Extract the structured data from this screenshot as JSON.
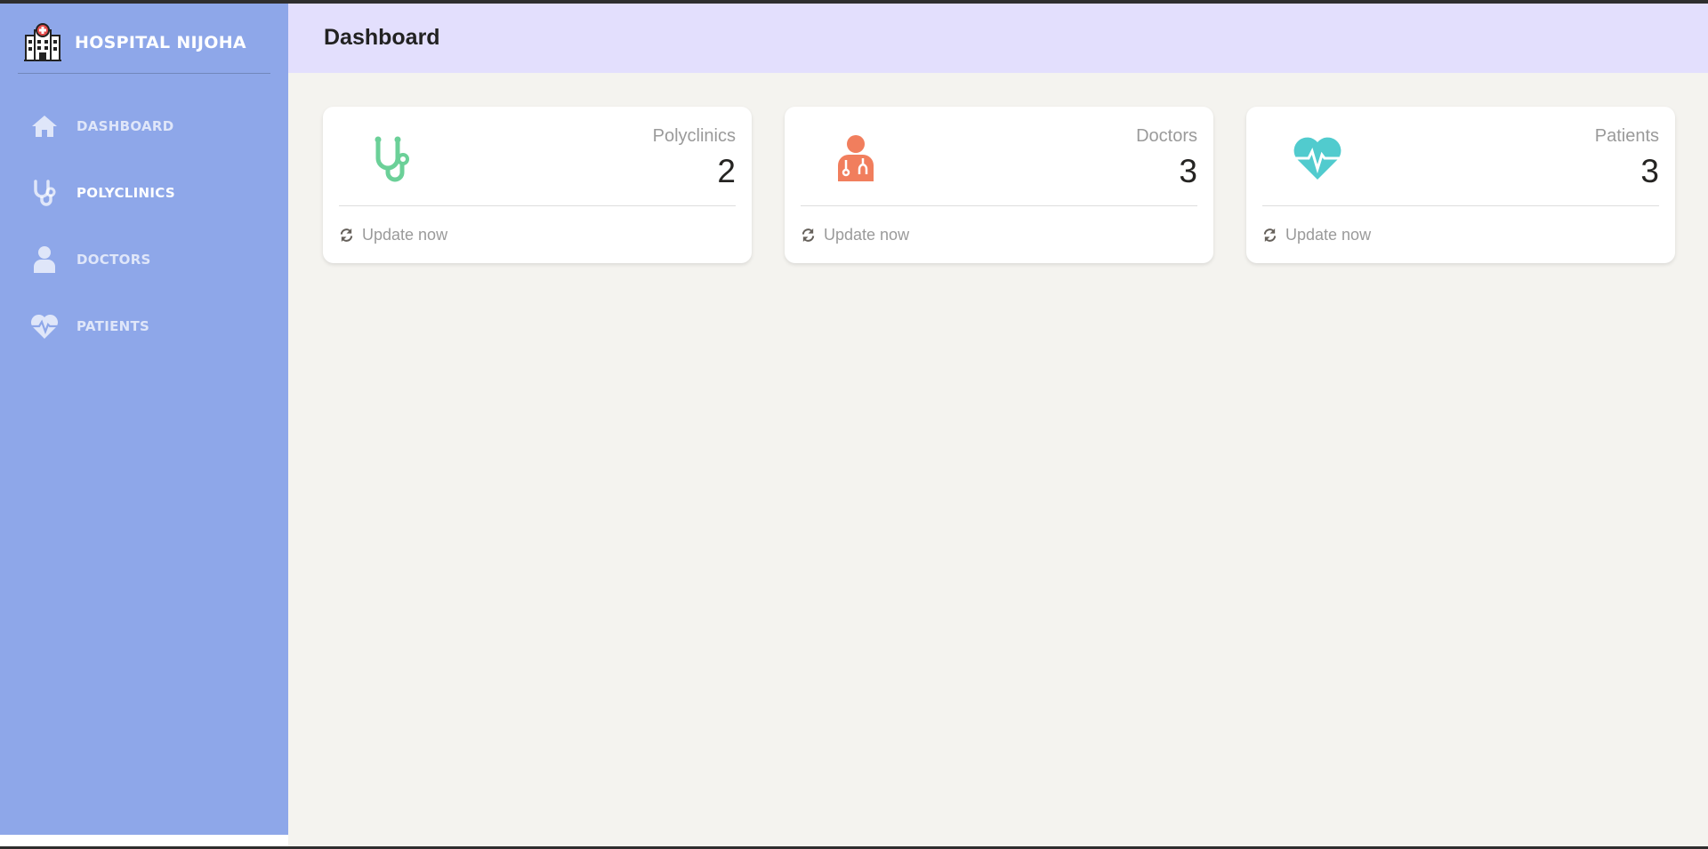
{
  "brand": {
    "name": "HOSPITAL NIJOHA",
    "logo": "hospital-building-icon"
  },
  "sidebar": {
    "items": [
      {
        "label": "DASHBOARD",
        "icon": "home-icon",
        "active": false
      },
      {
        "label": "POLYCLINICS",
        "icon": "stethoscope-icon",
        "active": true
      },
      {
        "label": "DOCTORS",
        "icon": "doctor-icon",
        "active": false
      },
      {
        "label": "PATIENTS",
        "icon": "heartbeat-icon",
        "active": false
      }
    ]
  },
  "header": {
    "title": "Dashboard"
  },
  "cards": [
    {
      "category": "Polyclinics",
      "count": "2",
      "footer": "Update now",
      "icon": "stethoscope-icon",
      "color": "#6bd098"
    },
    {
      "category": "Doctors",
      "count": "3",
      "footer": "Update now",
      "icon": "doctor-icon",
      "color": "#f17e5d"
    },
    {
      "category": "Patients",
      "count": "3",
      "footer": "Update now",
      "icon": "heartbeat-icon",
      "color": "#51cbce"
    }
  ],
  "colors": {
    "sidebar_bg": "#8ea7e9",
    "header_bg": "#e3dffd",
    "page_bg": "#f4f3ef"
  }
}
